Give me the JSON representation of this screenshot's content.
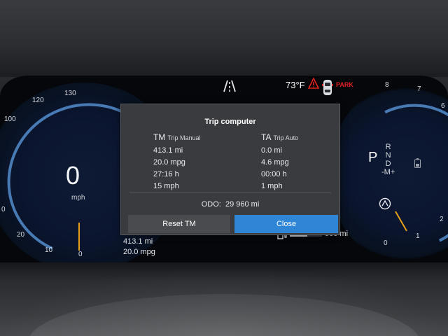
{
  "speedometer": {
    "ticks": [
      "130",
      "120",
      "100",
      "0",
      "20",
      "10",
      "0"
    ],
    "speed": "0",
    "unit": "mph"
  },
  "status": {
    "temperature": "73°F",
    "park_label": "PARK",
    "warning_color": "#e0201e"
  },
  "gear": {
    "current": "P",
    "options": [
      "R",
      "N",
      "D",
      "-M+"
    ]
  },
  "tach": {
    "ticks": [
      "8",
      "7",
      "6",
      "2",
      "1",
      "0"
    ]
  },
  "trip_computer": {
    "title": "Trip computer",
    "manual": {
      "abbr": "TM",
      "label": "Trip Manual",
      "distance": "413.1 mi",
      "consumption": "20.0 mpg",
      "time": "27:16 h",
      "avg_speed": "15 mph"
    },
    "auto": {
      "abbr": "TA",
      "label": "Trip Auto",
      "distance": "0.0 mi",
      "consumption": "4.6 mpg",
      "time": "00:00 h",
      "avg_speed": "1 mph"
    },
    "odo_label": "ODO:",
    "odo_value": "29 960 mi",
    "reset_button": "Reset TM",
    "close_button": "Close",
    "accent_color": "#2f86d6"
  },
  "bottom": {
    "trip_distance": "413.1 mi",
    "trip_consumption": "20.0 mpg",
    "range": "560 mi",
    "fuel_level": 0.55
  },
  "icons": {
    "road": "lane-road-icon",
    "warning": "warning-triangle-icon",
    "car": "car-top-view-icon",
    "battery": "battery-icon",
    "power": "power-gauge-icon",
    "fuel": "fuel-pump-icon"
  }
}
